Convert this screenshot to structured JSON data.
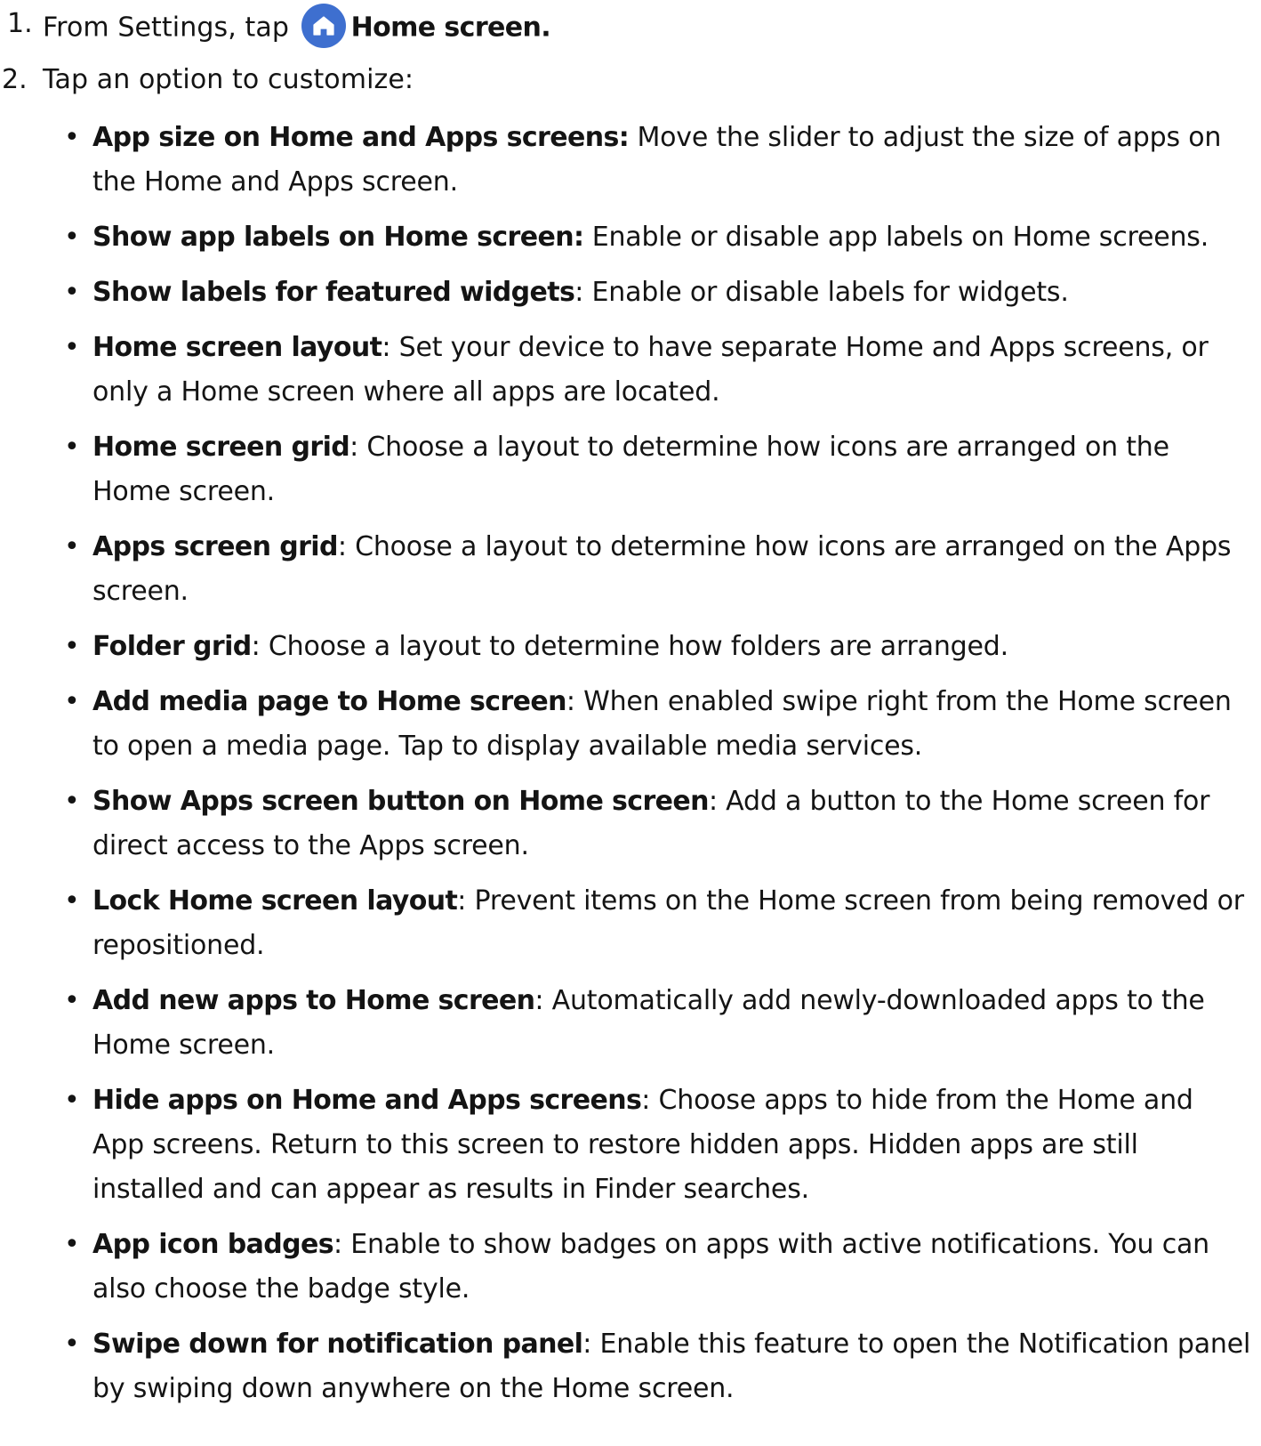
{
  "steps": [
    {
      "number": "1.",
      "prefix": "From Settings, tap",
      "icon": "home-icon",
      "bold": "Home screen",
      "suffix": "."
    },
    {
      "number": "2.",
      "text": "Tap an option to customize:"
    }
  ],
  "options": [
    {
      "term": "App size on Home and Apps screens:",
      "desc": " Move the slider to adjust the size of apps on the Home and Apps screen."
    },
    {
      "term": "Show app labels on Home screen:",
      "desc": " Enable or disable app labels on Home screens."
    },
    {
      "term": "Show labels for featured widgets",
      "desc": ": Enable or disable labels for widgets."
    },
    {
      "term": "Home screen layout",
      "desc": ": Set your device to have separate Home and Apps screens, or only a Home screen where all apps are located."
    },
    {
      "term": "Home screen grid",
      "desc": ": Choose a layout to determine how icons are arranged on the Home screen."
    },
    {
      "term": "Apps screen grid",
      "desc": ": Choose a layout to determine how icons are arranged on the Apps screen."
    },
    {
      "term": "Folder grid",
      "desc": ": Choose a layout to determine how folders are arranged."
    },
    {
      "term": "Add media page to Home screen",
      "desc": ": When enabled swipe right from the Home screen to open a media page. Tap to display available media services."
    },
    {
      "term": "Show Apps screen button on Home screen",
      "desc": ": Add a button to the Home screen for direct access to the Apps screen."
    },
    {
      "term": "Lock Home screen layout",
      "desc": ": Prevent items on the Home screen from being removed or repositioned."
    },
    {
      "term": "Add new apps to Home screen",
      "desc": ": Automatically add newly-downloaded apps to the Home screen."
    },
    {
      "term": "Hide apps on Home and Apps screens",
      "desc": ": Choose apps to hide from the Home and App screens. Return to this screen to restore hidden apps. Hidden apps are still installed and can appear as results in Finder searches."
    },
    {
      "term": "App icon badges",
      "desc": ": Enable to show badges on apps with active notifications. You can also choose the badge style."
    },
    {
      "term": "Swipe down for notification panel",
      "desc": ": Enable this feature to open the Notification panel by swiping down anywhere on the Home screen."
    }
  ],
  "colors": {
    "text": "#141414",
    "icon_background": "#3e6fcf"
  }
}
